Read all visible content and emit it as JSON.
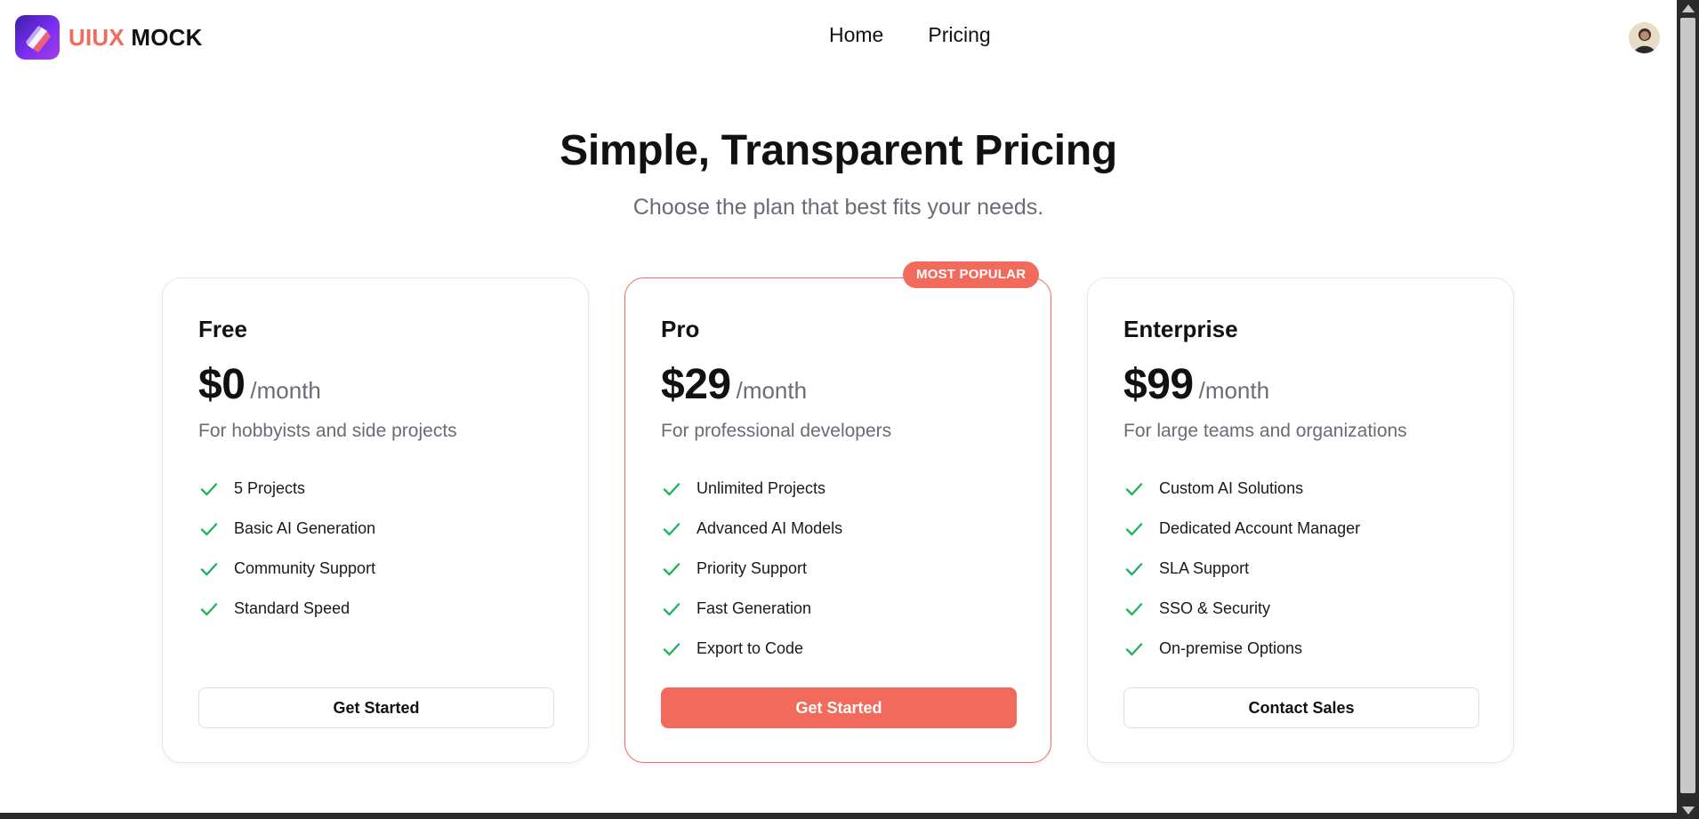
{
  "header": {
    "logo": {
      "brand_part1": "UIUX",
      "brand_part2": "MOCK",
      "icon": "uiux-logo-icon"
    },
    "nav": [
      {
        "label": "Home"
      },
      {
        "label": "Pricing"
      }
    ],
    "avatar_icon": "user-avatar"
  },
  "hero": {
    "title": "Simple, Transparent Pricing",
    "subtitle": "Choose the plan that best fits your needs."
  },
  "plans": [
    {
      "name": "Free",
      "price": "$0",
      "period": "/month",
      "description": "For hobbyists and side projects",
      "features": [
        "5 Projects",
        "Basic AI Generation",
        "Community Support",
        "Standard Speed"
      ],
      "cta": "Get Started"
    },
    {
      "name": "Pro",
      "badge": "MOST POPULAR",
      "price": "$29",
      "period": "/month",
      "description": "For professional developers",
      "features": [
        "Unlimited Projects",
        "Advanced AI Models",
        "Priority Support",
        "Fast Generation",
        "Export to Code"
      ],
      "cta": "Get Started"
    },
    {
      "name": "Enterprise",
      "price": "$99",
      "period": "/month",
      "description": "For large teams and organizations",
      "features": [
        "Custom AI Solutions",
        "Dedicated Account Manager",
        "SLA Support",
        "SSO & Security",
        "On-premise Options"
      ],
      "cta": "Contact Sales"
    }
  ],
  "colors": {
    "accent": "#f26a5c",
    "check": "#22b35e",
    "muted_text": "#6b6b73",
    "logo_gradient_start": "#3b1ea8",
    "logo_gradient_end": "#a33ce8"
  }
}
